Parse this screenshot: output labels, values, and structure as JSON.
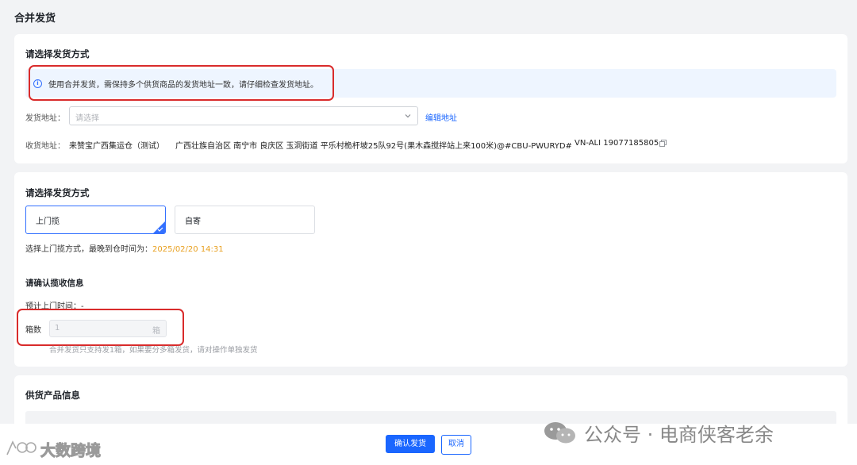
{
  "page": {
    "title": "合并发货"
  },
  "address_section": {
    "title": "请选择发货方式",
    "notice": "使用合并发货，需保持多个供货商品的发货地址一致，请仔细检查发货地址。",
    "ship_from_label": "发货地址：",
    "ship_from_placeholder": "请选择",
    "edit_address_link": "编辑地址",
    "receiver_label": "收货地址：",
    "receiver_name": "来赞宝广西集运仓（测试）",
    "receiver_address": "广西壮族自治区 南宁市 良庆区 玉洞街道 平乐村桅杆坡25队92号(果木森搅拌站上来100米)@#CBU-PWURYD#",
    "receiver_phone": "VN-ALI 19077185805"
  },
  "method_section": {
    "title": "请选择发货方式",
    "options": [
      {
        "label": "上门揽",
        "selected": true
      },
      {
        "label": "自寄",
        "selected": false
      }
    ],
    "deadline_prefix": "选择上门揽方式，最晚到仓时间为：",
    "deadline_value": "2025/02/20 14:31",
    "confirm_title": "请确认揽收信息",
    "pickup_time_label": "预计上门时间：",
    "pickup_time_value": "-",
    "box_label": "箱数",
    "box_value": "1",
    "box_unit": "箱",
    "box_hint": "合并发货只支持发1箱，如果要分多箱发货，请对操作单独发货"
  },
  "product_section": {
    "title": "供货产品信息"
  },
  "footer": {
    "confirm_button": "确认发货",
    "cancel_button": "取消"
  },
  "watermarks": {
    "left": "大数跨境",
    "right": "公众号 · 电商侠客老余"
  },
  "colors": {
    "accent": "#1a66ff",
    "highlight": "#d92b2b",
    "deadline": "#e8a020",
    "notice_bg": "#eef5ff"
  }
}
